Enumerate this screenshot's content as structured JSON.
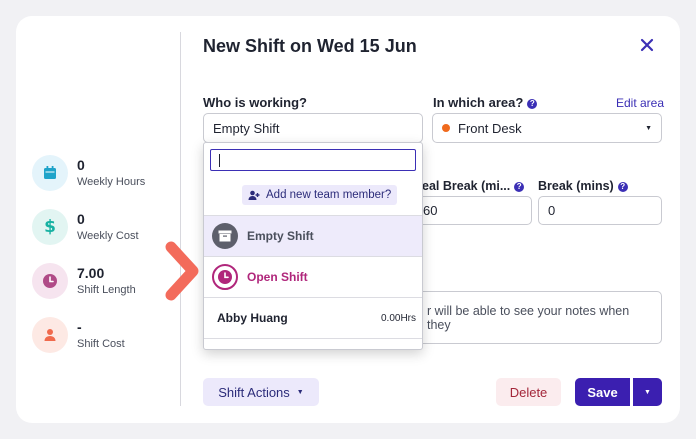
{
  "summary": [
    {
      "value": "0",
      "label": "Weekly Hours",
      "icon": "calendar-icon",
      "color": "#1fa3c9",
      "bg": "#e4f4fb"
    },
    {
      "value": "0",
      "label": "Weekly Cost",
      "icon": "dollar-icon",
      "color": "#17b1a2",
      "bg": "#e2f5f2"
    },
    {
      "value": "7.00",
      "label": "Shift Length",
      "icon": "clock-icon",
      "color": "#b04a87",
      "bg": "#f6e4ef"
    },
    {
      "value": "-",
      "label": "Shift Cost",
      "icon": "person-icon",
      "color": "#f06a4d",
      "bg": "#fde9e4"
    }
  ],
  "dialog": {
    "title": "New Shift on Wed 15 Jun",
    "who_label": "Who is working?",
    "who_value": "Empty Shift",
    "area_label": "In which area?",
    "edit_area": "Edit area",
    "area_value": "Front Desk",
    "area_dot_color": "#f06a1d",
    "meal_break_label": "eal Break (mi...",
    "meal_break_value": "60",
    "break_label": "Break (mins)",
    "break_value": "0",
    "notes_text": "r will be able to see your notes when they"
  },
  "dropdown": {
    "search_value": "",
    "add_member": "Add new team member?",
    "items": [
      {
        "name": "Empty Shift",
        "icon": "archive-icon"
      },
      {
        "name": "Open Shift",
        "icon": "clock-icon",
        "color": "#b0267b"
      },
      {
        "name": "Abby Huang",
        "hours": "0.00Hrs"
      }
    ]
  },
  "footer": {
    "shift_actions": "Shift Actions",
    "delete": "Delete",
    "save": "Save"
  },
  "colors": {
    "accent": "#3b2fb5",
    "annotation_arrow": "#f36b5b"
  }
}
